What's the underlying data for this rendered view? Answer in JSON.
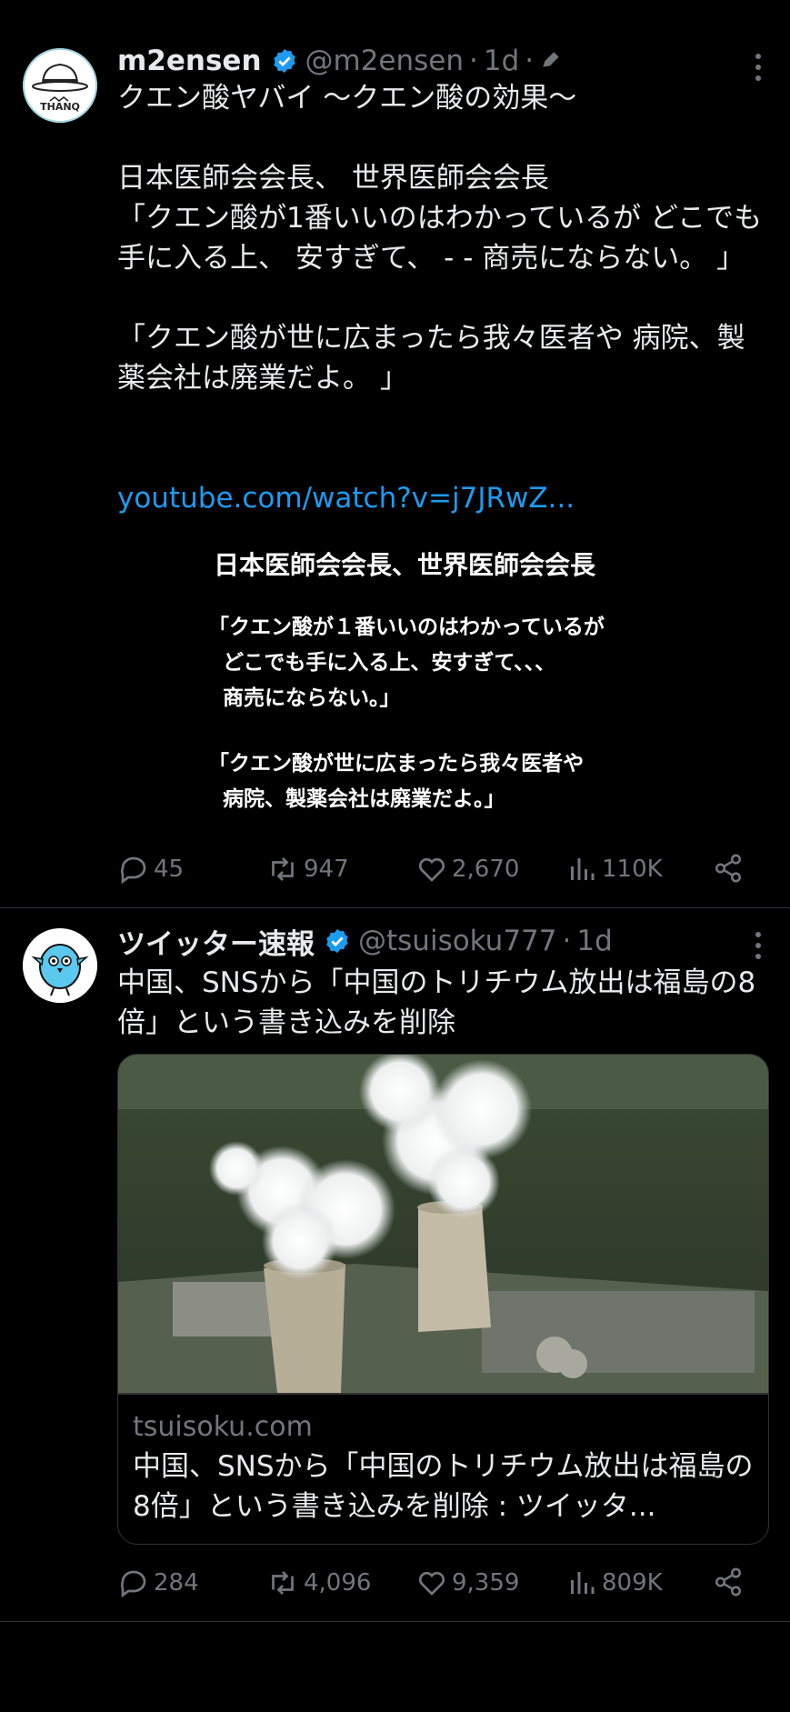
{
  "tweets": [
    {
      "display_name": "m2ensen",
      "handle": "@m2ensen",
      "dot": "·",
      "time": "1d",
      "avatar_label": "THANQ",
      "text": "クエン酸ヤバイ ～クエン酸の効果～\n\n日本医師会会長、 世界医師会会長\n「クエン酸が1番いいのはわかっているが どこでも手に入る上、 安すぎて、 - - 商売にならない。 」\n\n「クエン酸が世に広まったら我々医者や 病院、製薬会社は廃業だよ。 」",
      "link": "youtube.com/watch?v=j7JRwZ...",
      "image_text": {
        "title": "日本医師会会長、世界医師会会長",
        "lines": [
          "「クエン酸が１番いいのはわかっているが",
          "  どこでも手に入る上、安すぎて、、、",
          "  商売にならない。」",
          "「クエン酸が世に広まったら我々医者や",
          "  病院、製薬会社は廃業だよ。」"
        ]
      },
      "replies": "45",
      "retweets": "947",
      "likes": "2,670",
      "views": "110K"
    },
    {
      "display_name": "ツイッター速報",
      "handle": "@tsuisoku777",
      "dot": "·",
      "time": "1d",
      "text": "中国、SNSから「中国のトリチウム放出は福島の8倍」という書き込みを削除",
      "card": {
        "domain": "tsuisoku.com",
        "title": "中国、SNSから「中国のトリチウム放出は福島の8倍」という書き込みを削除 : ツイッタ..."
      },
      "replies": "284",
      "retweets": "4,096",
      "likes": "9,359",
      "views": "809K"
    }
  ],
  "colors": {
    "accent": "#1d9bf0",
    "muted": "#71767b",
    "text": "#e7e9ea",
    "background": "#000000"
  }
}
